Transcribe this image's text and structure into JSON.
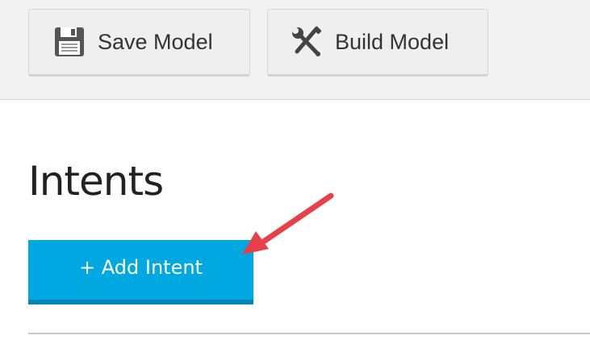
{
  "toolbar": {
    "save": {
      "label": "Save Model",
      "icon": "floppy-disk-icon"
    },
    "build": {
      "label": "Build Model",
      "icon": "wrench-screwdriver-icon"
    }
  },
  "main": {
    "title": "Intents",
    "add_button": {
      "label": "+ Add Intent",
      "color": "#00a8e1"
    }
  },
  "annotation": {
    "icon": "red-arrow-icon",
    "color": "#e8404a"
  }
}
